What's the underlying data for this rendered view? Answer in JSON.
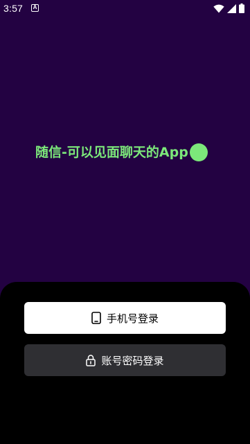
{
  "status_bar": {
    "time": "3:57",
    "notification_icon": "A",
    "icons": [
      "wifi-icon",
      "signal-icon",
      "battery-icon"
    ]
  },
  "hero": {
    "title": "随信-可以见面聊天的App",
    "accent_color": "#7ce87a",
    "background_color": "#230242"
  },
  "login": {
    "phone_label": "手机号登录",
    "password_label": "账号密码登录",
    "phone_icon": "phone-icon",
    "password_icon": "lock-icon"
  }
}
